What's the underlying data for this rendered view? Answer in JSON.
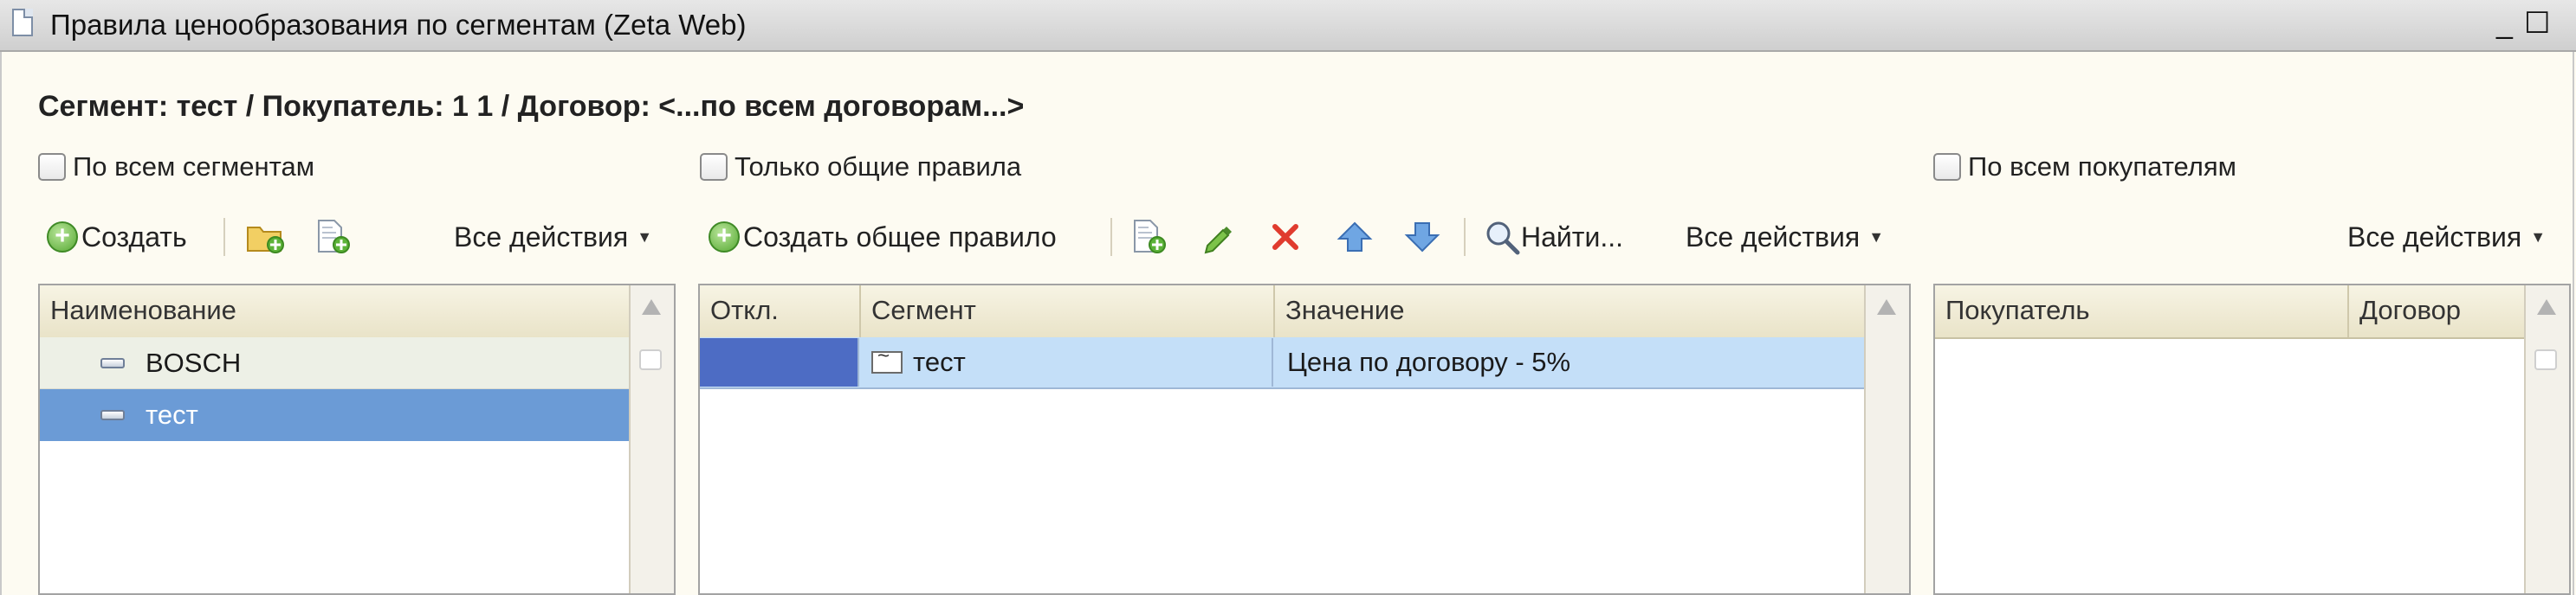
{
  "window": {
    "title": "Правила ценообразования по сегментам (Zeta Web)",
    "minimize_glyph": "_",
    "maximize_glyph": "☐"
  },
  "header": {
    "context_line": "Сегмент: тест / Покупатель: 1 1 / Договор: <...по всем договорам...>"
  },
  "checkboxes": {
    "all_segments": {
      "label": "По всем сегментам",
      "checked": false
    },
    "common_rules_only": {
      "label": "Только общие правила",
      "checked": false
    },
    "all_buyers": {
      "label": "По всем покупателям",
      "checked": false
    }
  },
  "left_toolbar": {
    "create_label": "Создать",
    "all_actions_label": "Все действия"
  },
  "middle_toolbar": {
    "create_common_label": "Создать общее правило",
    "find_label": "Найти...",
    "all_actions_label": "Все действия"
  },
  "right_toolbar": {
    "all_actions_label": "Все действия"
  },
  "segments_table": {
    "column": "Наименование",
    "rows": [
      {
        "name": "BOSCH",
        "selected": false
      },
      {
        "name": "тест",
        "selected": true
      }
    ]
  },
  "rules_table": {
    "columns": [
      "Откл.",
      "Сегмент",
      "Значение"
    ],
    "rows": [
      {
        "disabled": "",
        "segment": "тест",
        "value": "Цена по договору - 5%"
      }
    ]
  },
  "buyers_table": {
    "columns": [
      "Покупатель",
      "Договор"
    ],
    "rows": []
  },
  "colors": {
    "selection_blue": "#6b9bd6",
    "row_highlight": "#c4dff8",
    "cell_cursor": "#4d6cc4",
    "background": "#fdfbf2"
  }
}
